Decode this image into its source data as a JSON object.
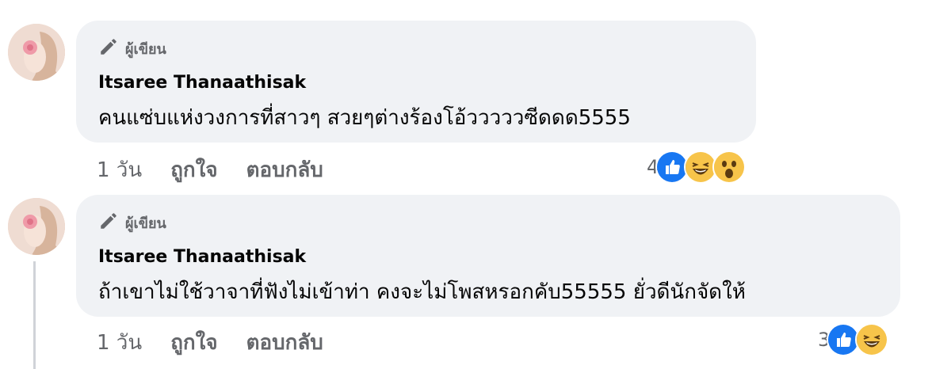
{
  "comments": [
    {
      "author_badge": "ผู้เขียน",
      "author_name": "Itsaree Thanaathisak",
      "text": "คนแซ่บแห่งวงการที่สาวๆ สวยๆต่างร้องโอ้วววววซีดดด5555",
      "time": "1 วัน",
      "like_label": "ถูกใจ",
      "reply_label": "ตอบกลับ",
      "reaction_count": "4",
      "reactions": [
        "like-icon",
        "laugh-emoji-icon",
        "wow-emoji-icon"
      ]
    },
    {
      "author_badge": "ผู้เขียน",
      "author_name": "Itsaree Thanaathisak",
      "text": "ถ้าเขาไม่ใช้วาจาที่ฟังไม่เข้าท่า คงจะไม่โพสหรอกคับ55555 ยั่วดีนักจัดให้",
      "time": "1 วัน",
      "like_label": "ถูกใจ",
      "reply_label": "ตอบกลับ",
      "reaction_count": "3",
      "reactions": [
        "like-icon",
        "laugh-emoji-icon"
      ]
    }
  ],
  "colors": {
    "bubble": "#f0f2f5",
    "text": "#050505",
    "secondary": "#65676b",
    "like_blue": "#1877f2"
  }
}
